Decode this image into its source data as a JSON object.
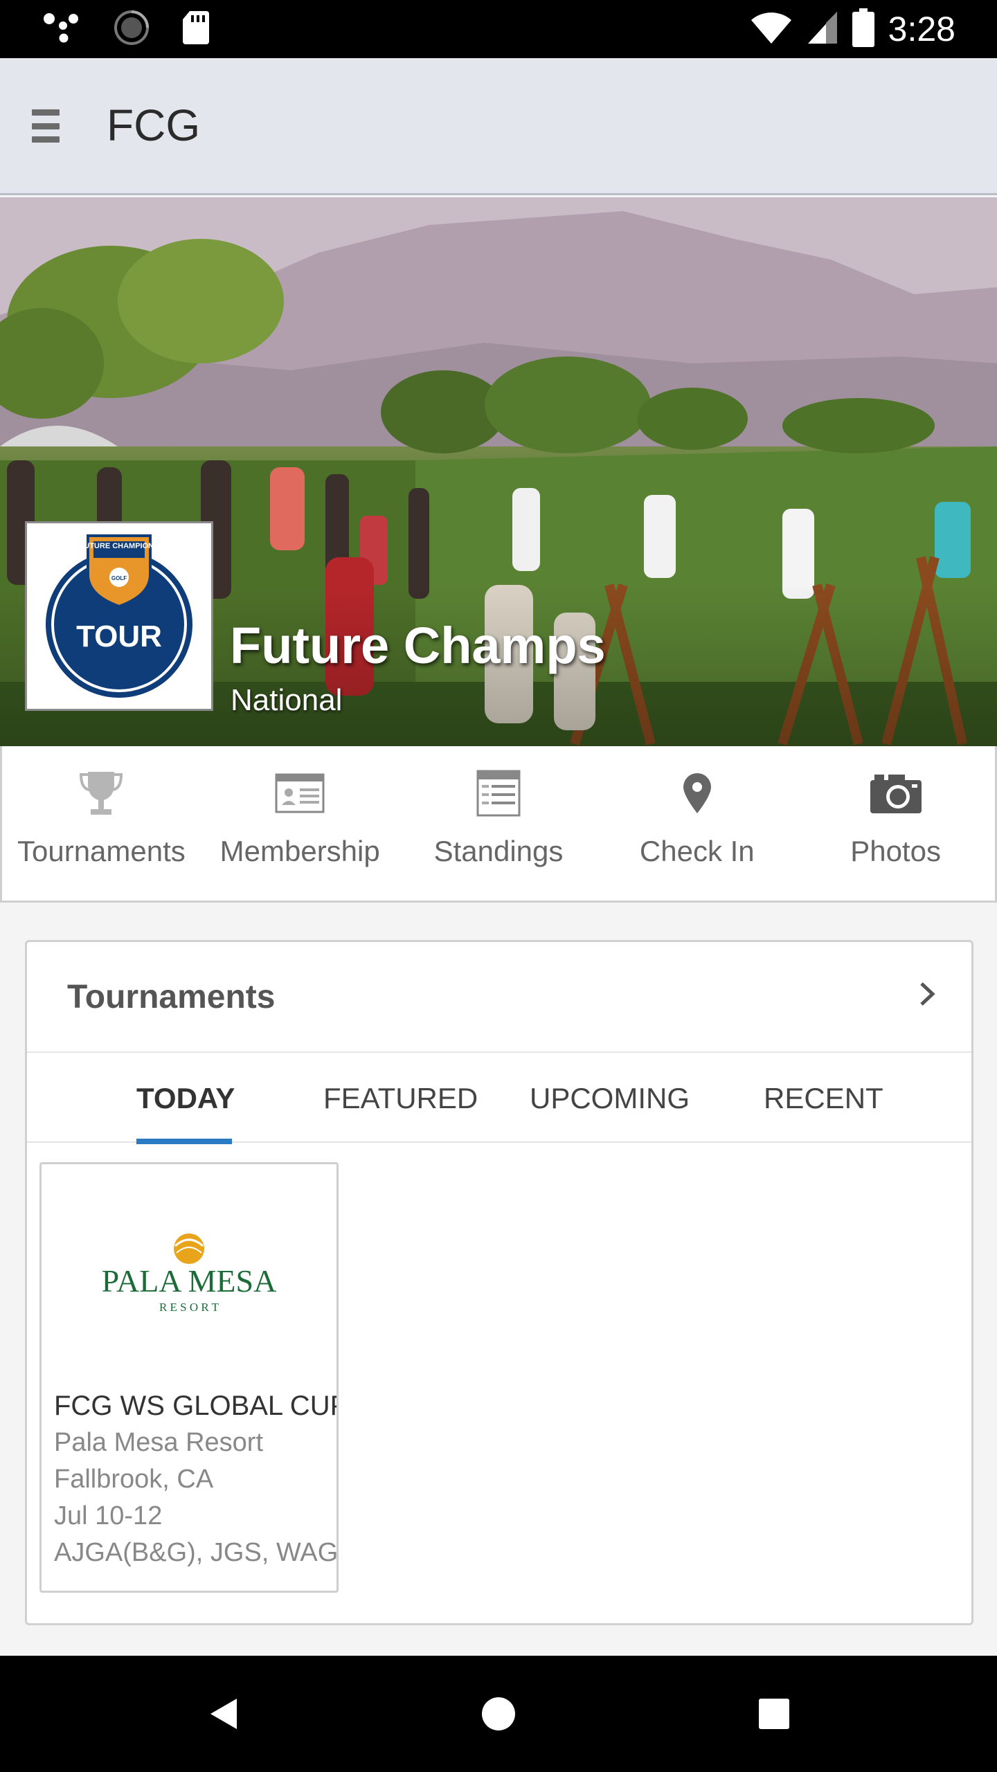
{
  "status_bar": {
    "time": "3:28",
    "icons": [
      "assistant-dots-icon",
      "sync-circle-icon",
      "sd-card-icon",
      "wifi-icon",
      "signal-icon",
      "battery-icon"
    ]
  },
  "app_bar": {
    "title": "FCG",
    "menu_icon": "hamburger-menu-icon"
  },
  "hero": {
    "name": "Future Champs",
    "subtitle": "National",
    "logo": {
      "top_text": "FUTURE CHAMPIONS",
      "badge_text": "GOLF",
      "main_text": "TOUR"
    }
  },
  "actions": [
    {
      "label": "Tournaments",
      "icon": "trophy-icon"
    },
    {
      "label": "Membership",
      "icon": "membership-card-icon"
    },
    {
      "label": "Standings",
      "icon": "standings-board-icon"
    },
    {
      "label": "Check In",
      "icon": "location-pin-icon"
    },
    {
      "label": "Photos",
      "icon": "camera-icon"
    }
  ],
  "tournaments_card": {
    "title": "Tournaments",
    "tabs": [
      {
        "label": "TODAY",
        "active": true
      },
      {
        "label": "FEATURED",
        "active": false
      },
      {
        "label": "UPCOMING",
        "active": false
      },
      {
        "label": "RECENT",
        "active": false
      }
    ],
    "items": [
      {
        "logo_name": "PALA MESA",
        "logo_sub": "R E S O R T",
        "name": "FCG WS GLOBAL CUP",
        "venue": "Pala Mesa Resort",
        "location": "Fallbrook, CA",
        "dates": "Jul 10-12",
        "tags": "AJGA(B&G), JGS, WAGR"
      }
    ]
  },
  "nav_bar": {
    "buttons": [
      "back-triangle-icon",
      "home-circle-icon",
      "recents-square-icon"
    ]
  },
  "colors": {
    "accent": "#2a7bc3",
    "app_bar": "#e3e6ed",
    "logo_blue": "#0f3d7a",
    "logo_orange": "#e8952a",
    "resort_green": "#1e6b3a"
  }
}
